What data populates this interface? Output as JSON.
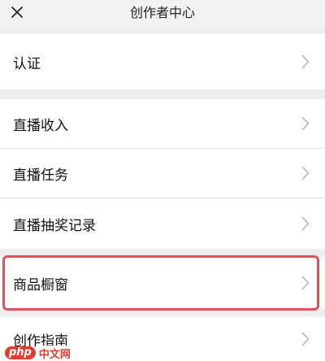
{
  "header": {
    "title": "创作者中心",
    "close_icon": "close-icon"
  },
  "menu": {
    "items": [
      {
        "label": "认证"
      },
      {
        "label": "直播收入"
      },
      {
        "label": "直播任务"
      },
      {
        "label": "直播抽奖记录"
      },
      {
        "label": "商品橱窗"
      },
      {
        "label": "创作指南"
      }
    ],
    "chevron_icon": "chevron-right-icon"
  },
  "highlight": {
    "item": "商品橱窗",
    "color": "#e0505a"
  },
  "watermark": {
    "badge": "php",
    "text": "中文网"
  }
}
